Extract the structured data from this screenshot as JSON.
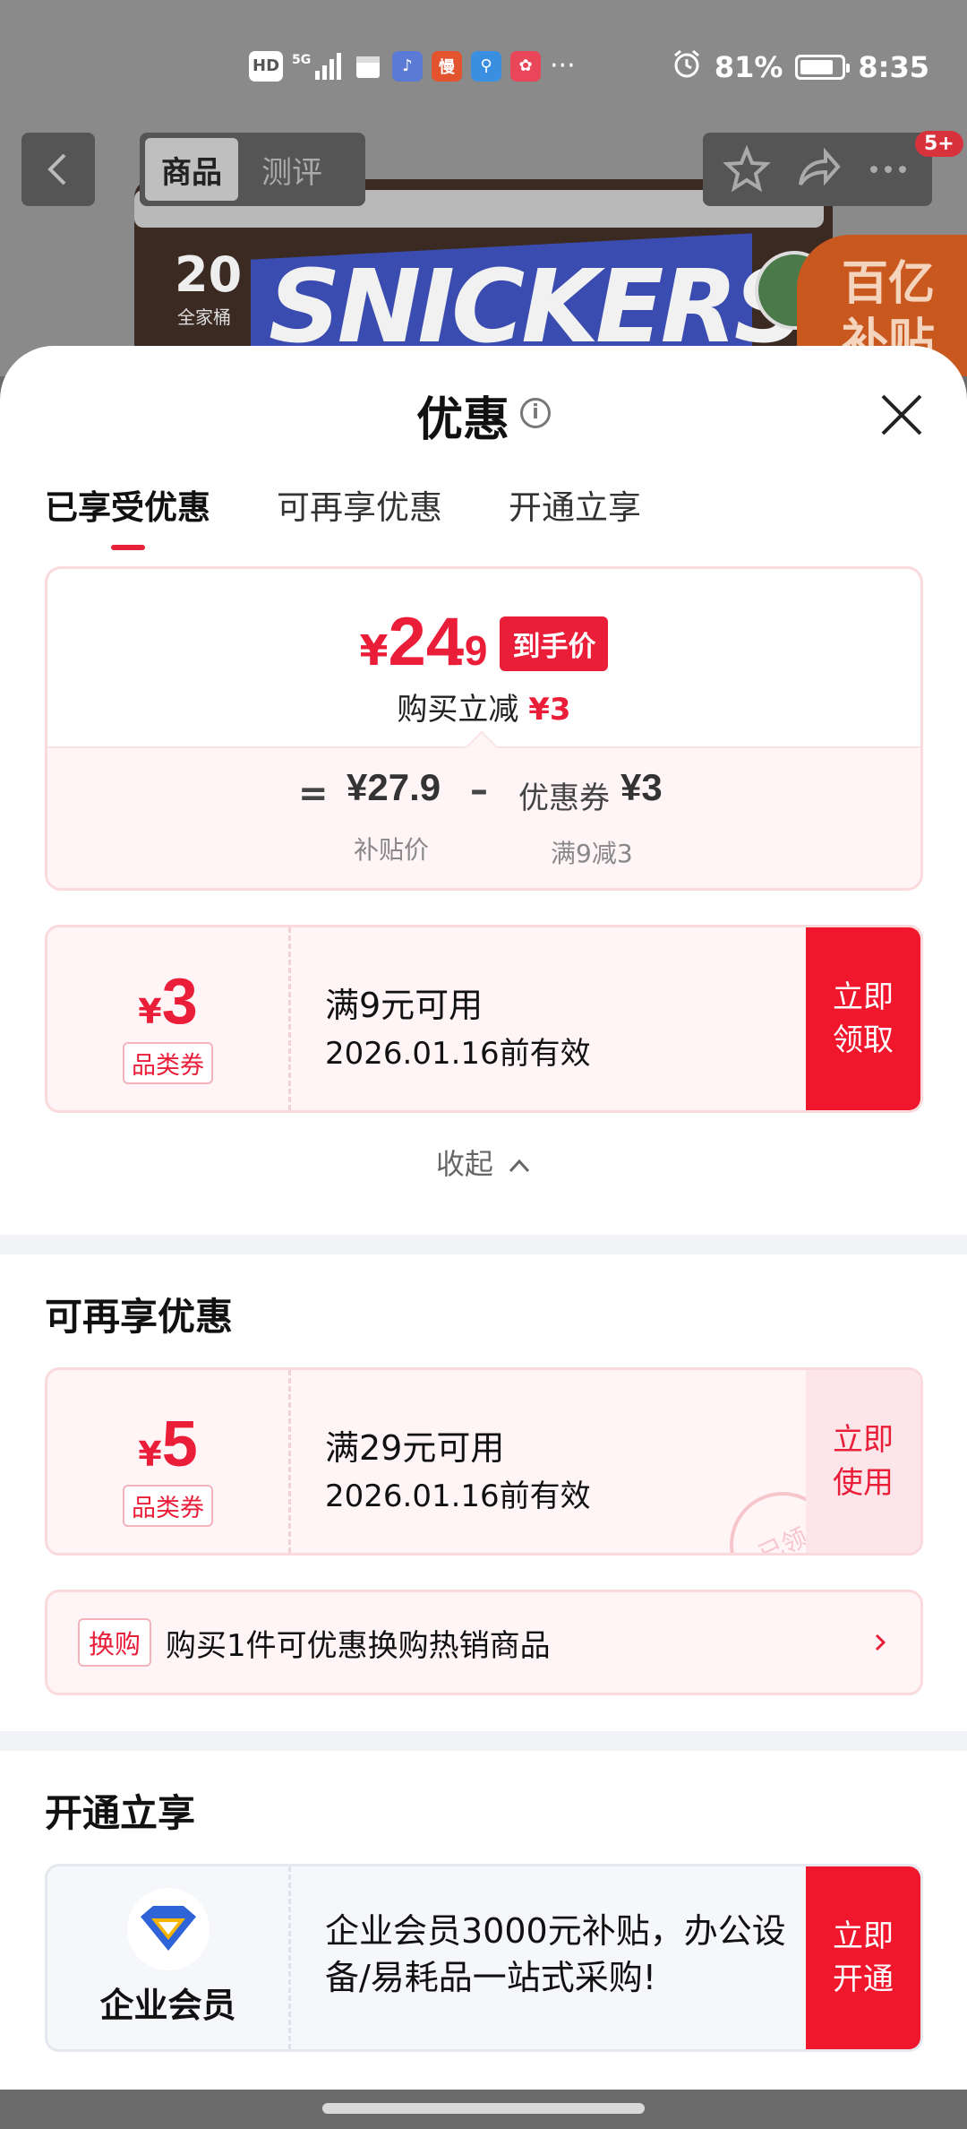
{
  "status_bar": {
    "left_icons": [
      "HD",
      "5G",
      "signal",
      "calendar",
      "music",
      "慢",
      "map",
      "app"
    ],
    "more": "···",
    "battery": "81%",
    "time": "8:35"
  },
  "product_page": {
    "tabs": [
      "商品",
      "测评"
    ],
    "badge": "5+",
    "product_count": "20",
    "product_count_sub": "全家桶",
    "brand": "SNICKERS",
    "promo_badge": "百亿\n补贴"
  },
  "sheet": {
    "title": "优惠",
    "info_glyph": "i",
    "tabs": [
      "已享受优惠",
      "可再享优惠",
      "开通立享"
    ],
    "price_summary": {
      "currency": "¥",
      "final_int": "24",
      "final_dec": ".9",
      "final_tag": "到手价",
      "reduce_label": "购买立减",
      "reduce_value": "¥3",
      "eq": "=",
      "subsidy_price": "¥27.9",
      "subsidy_label": "补贴价",
      "minus": "–",
      "coupon_label": "优惠券",
      "coupon_value": "¥3",
      "coupon_rule": "满9减3"
    },
    "coupon1": {
      "currency": "¥",
      "amount": "3",
      "type": "品类券",
      "condition": "满9元可用",
      "expiry": "2026.01.16前有效",
      "action": "立即\n领取"
    },
    "collapse_label": "收起",
    "section2_title": "可再享优惠",
    "coupon2": {
      "currency": "¥",
      "amount": "5",
      "type": "品类券",
      "condition": "满29元可用",
      "expiry": "2026.01.16前有效",
      "action": "立即\n使用",
      "stamp": "已领"
    },
    "trade_in": {
      "tag": "换购",
      "text": "购买1件可优惠换购热销商品"
    },
    "section3_title": "开通立享",
    "member": {
      "name": "企业会员",
      "desc": "企业会员3000元补贴，办公设备/易耗品一站式采购!",
      "action": "立即\n开通"
    }
  },
  "colors": {
    "accent": "#ea1e39",
    "action_red": "#f0172c",
    "card_bg": "#fff5f6"
  }
}
